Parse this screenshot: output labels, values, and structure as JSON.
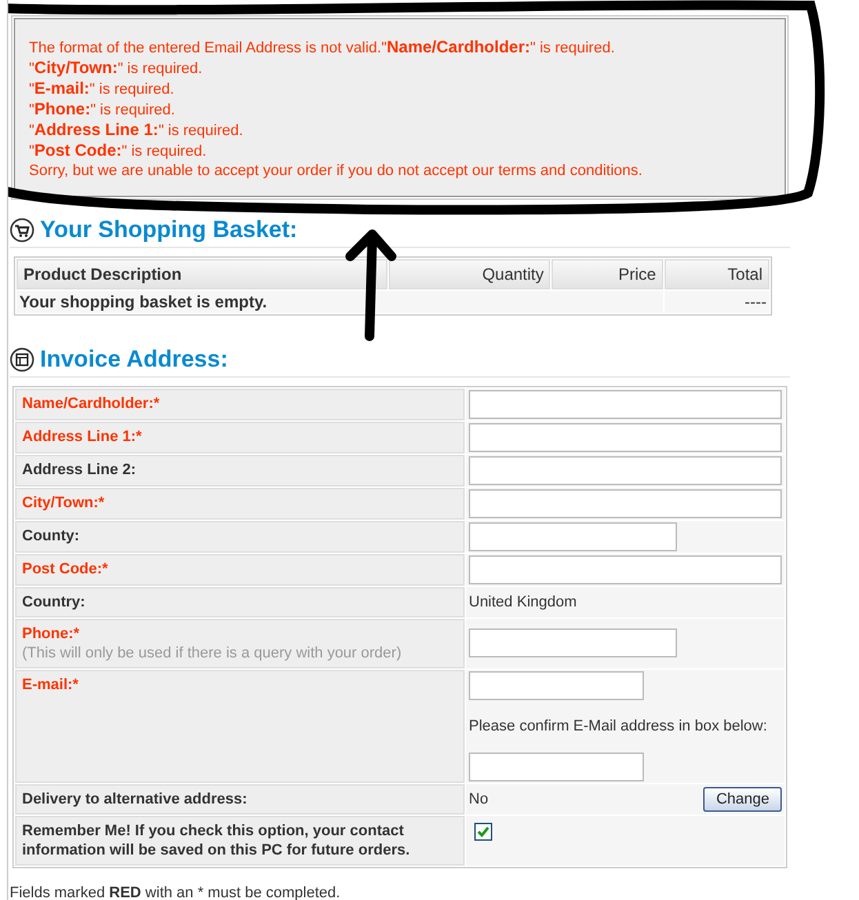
{
  "errors": [
    "The format of the entered Email Address is not valid.\"**Name/Cardholder:**\" is required.",
    "\"**City/Town:**\" is required.",
    "\"**E-mail:**\" is required.",
    "\"**Phone:**\" is required.",
    "\"**Address Line 1:**\" is required.",
    "\"**Post Code:**\" is required.",
    "Sorry, but we are unable to accept your order if you do not accept our terms and conditions."
  ],
  "basket": {
    "heading": "Your Shopping Basket:",
    "columns": [
      "Product Description",
      "Quantity",
      "Price",
      "Total"
    ],
    "empty_message": "Your shopping basket is empty.",
    "total": "----"
  },
  "invoice": {
    "heading": "Invoice Address:",
    "rows": [
      {
        "kind": "input",
        "label": "Name/Cardholder:*",
        "required": true,
        "wide": true
      },
      {
        "kind": "input",
        "label": "Address Line 1:*",
        "required": true,
        "wide": true
      },
      {
        "kind": "input",
        "label": "Address Line 2:",
        "required": false,
        "wide": true
      },
      {
        "kind": "input",
        "label": "City/Town:*",
        "required": true,
        "wide": true
      },
      {
        "kind": "input",
        "label": "County:",
        "required": false,
        "wide": false
      },
      {
        "kind": "input",
        "label": "Post Code:*",
        "required": true,
        "wide": true
      },
      {
        "kind": "text",
        "label": "Country:",
        "required": false,
        "value": "United Kingdom"
      },
      {
        "kind": "input",
        "label": "Phone:*",
        "required": true,
        "wide": false,
        "note": "(This will only be used if there is a query with your order)"
      },
      {
        "kind": "email",
        "label": "E-mail:*",
        "required": true,
        "confirm": "Please confirm E-Mail address in box below:"
      },
      {
        "kind": "delivery",
        "label": "Delivery to alternative address:",
        "required": false,
        "value": "No",
        "button": "Change"
      },
      {
        "kind": "checkbox",
        "label": "Remember Me! If you check this option, your contact information will be saved on this PC for future orders.",
        "required": false,
        "checked": true
      }
    ]
  },
  "footer": "Fields marked **RED** with an * must be completed."
}
